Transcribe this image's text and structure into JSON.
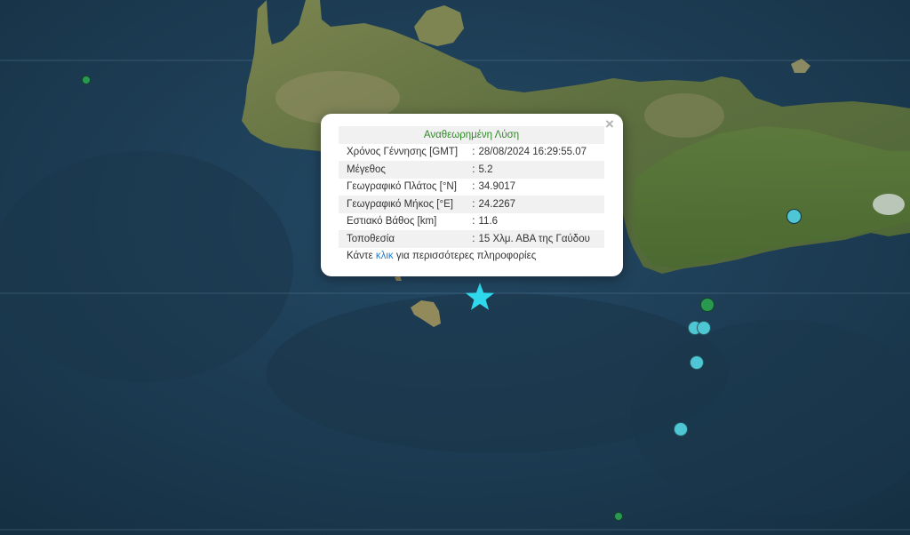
{
  "popup": {
    "title": "Αναθεωρημένη Λύση",
    "close_symbol": "×",
    "rows": [
      {
        "label": "Χρόνος Γέννησης [GMT]",
        "value": "28/08/2024 16:29:55.07"
      },
      {
        "label": "Μέγεθος",
        "value": "5.2"
      },
      {
        "label": "Γεωγραφικό Πλάτος [°N]",
        "value": "34.9017"
      },
      {
        "label": "Γεωγραφικό Μήκος [°E]",
        "value": "24.2267"
      },
      {
        "label": "Εστιακό Βάθος [km]",
        "value": "11.6"
      },
      {
        "label": "Τοποθεσία",
        "value": "15 Χλμ. ΑΒΑ της Γαύδου"
      }
    ],
    "separator": ":",
    "footer_before": "Κάντε",
    "footer_link": "κλικ",
    "footer_after": "για περισσότερες πληροφορίες"
  },
  "map": {
    "sea_color": "#1d3a52",
    "land_color": "#6d7a45",
    "epicenter_icon": "star-icon",
    "epicenter_color": "#2fd9ec",
    "marker_colors": {
      "green": "#2a9950",
      "cyan": "#4fc6d4"
    }
  }
}
